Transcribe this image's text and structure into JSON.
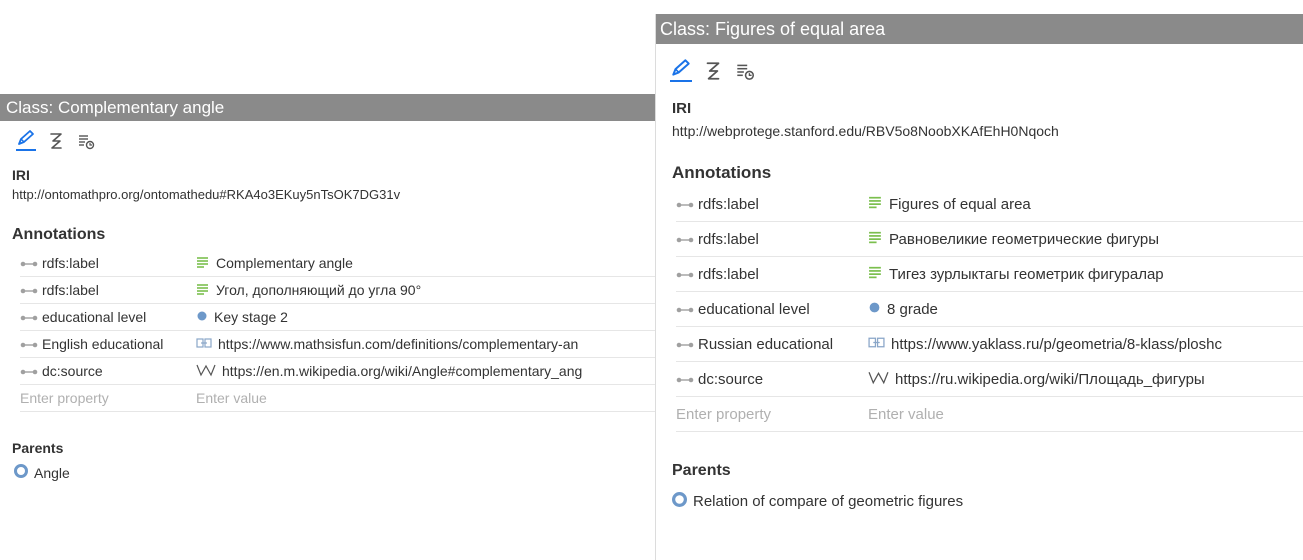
{
  "left": {
    "title": "Class: Complementary angle",
    "tools": [
      "edit-pencil-icon",
      "axioms-icon",
      "frames-icon"
    ],
    "iri_label": "IRI",
    "iri": "http://ontomathpro.org/ontomathedu#RKA4o3EKuy5nTsOK7DG31v",
    "annotations_label": "Annotations",
    "annotations": [
      {
        "property": "rdfs:label",
        "value": "Complementary angle",
        "value_icon": "text-lines-icon"
      },
      {
        "property": "rdfs:label",
        "value": "Угол, дополняющий до угла 90°",
        "value_icon": "text-lines-icon"
      },
      {
        "property": "educational level",
        "value": "Key stage 2",
        "value_icon": "dot-icon"
      },
      {
        "property": "English educational",
        "value": "https://www.mathsisfun.com/definitions/complementary-an",
        "value_icon": "link-icon"
      },
      {
        "property": "dc:source",
        "value": "https://en.m.wikipedia.org/wiki/Angle#complementary_ang",
        "value_icon": "wikipedia-icon"
      }
    ],
    "enter_property": "Enter property",
    "enter_value": "Enter value",
    "parents_label": "Parents",
    "parents": [
      "Angle"
    ]
  },
  "right": {
    "title": "Class: Figures of equal area",
    "tools": [
      "edit-pencil-icon",
      "axioms-icon",
      "frames-icon"
    ],
    "iri_label": "IRI",
    "iri": "http://webprotege.stanford.edu/RBV5o8NoobXKAfEhH0Nqoch",
    "annotations_label": "Annotations",
    "annotations": [
      {
        "property": "rdfs:label",
        "value": "Figures of equal area",
        "value_icon": "text-lines-icon"
      },
      {
        "property": "rdfs:label",
        "value": "Равновеликие геометрические фигуры",
        "value_icon": "text-lines-icon"
      },
      {
        "property": "rdfs:label",
        "value": "Тигез зурлыктагы геометрик фигуралар",
        "value_icon": "text-lines-icon"
      },
      {
        "property": "educational level",
        "value": "8 grade",
        "value_icon": "dot-icon"
      },
      {
        "property": "Russian educational",
        "value": "https://www.yaklass.ru/p/geometria/8-klass/ploshc",
        "value_icon": "link-icon"
      },
      {
        "property": "dc:source",
        "value": "https://ru.wikipedia.org/wiki/Площадь_фигуры",
        "value_icon": "wikipedia-icon"
      }
    ],
    "enter_property": "Enter property",
    "enter_value": "Enter value",
    "parents_label": "Parents",
    "parents": [
      "Relation of compare of geometric figures"
    ]
  },
  "colors": {
    "title_bar": "#8a8a8a",
    "accent": "#1a73e8",
    "text_icon": "#7bbf4e",
    "dot": "#6d98c9",
    "property_icon": "#a0a0a0",
    "placeholder": "#b0b0b0"
  }
}
